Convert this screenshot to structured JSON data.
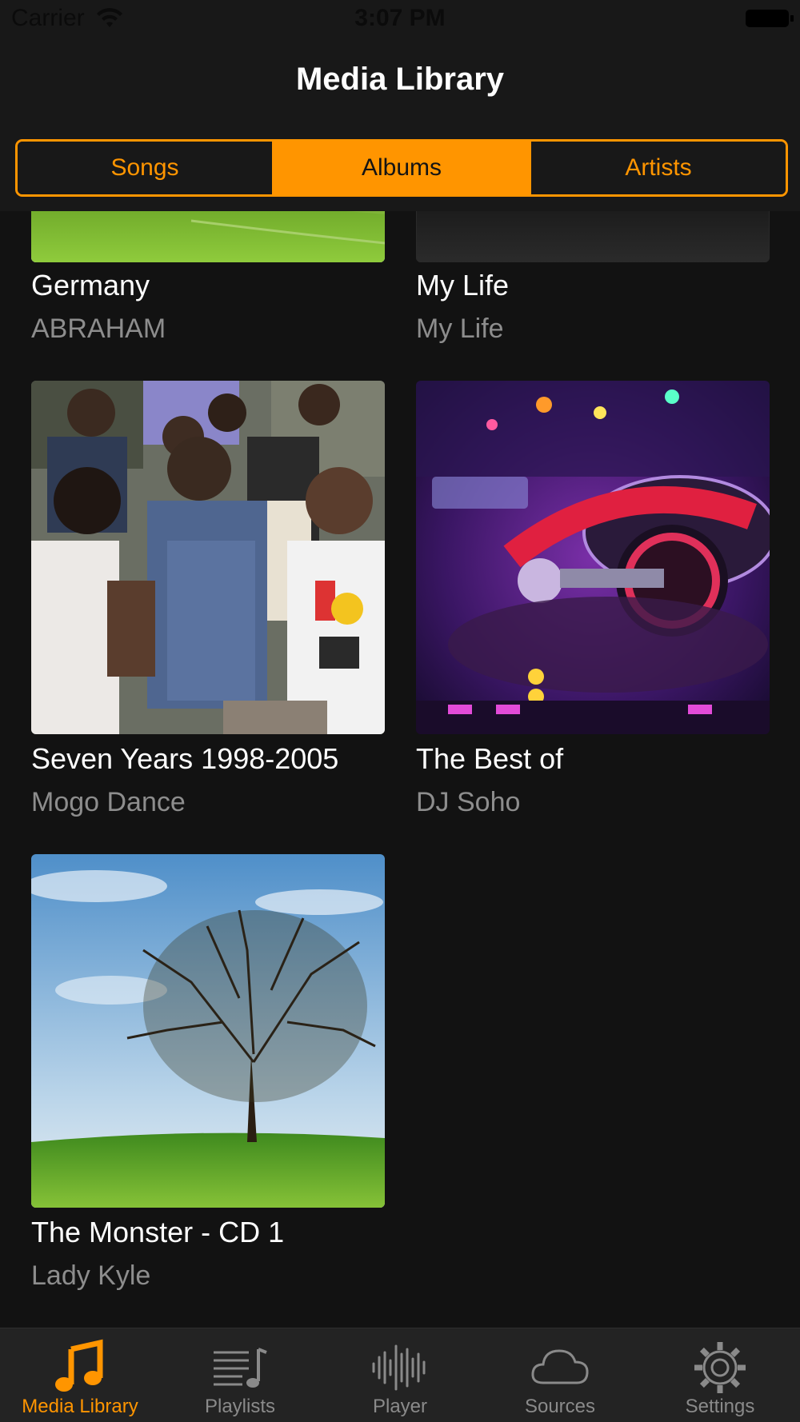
{
  "status_bar": {
    "carrier": "Carrier",
    "time": "3:07 PM"
  },
  "nav": {
    "title": "Media Library"
  },
  "segments": [
    {
      "label": "Songs",
      "active": false
    },
    {
      "label": "Albums",
      "active": true
    },
    {
      "label": "Artists",
      "active": false
    }
  ],
  "albums": [
    {
      "title": "Germany",
      "artist": "ABRAHAM"
    },
    {
      "title": "My Life",
      "artist": "My Life"
    },
    {
      "title": "Seven Years 1998-2005",
      "artist": "Mogo Dance"
    },
    {
      "title": "The Best of",
      "artist": "DJ Soho"
    },
    {
      "title": "The Monster - CD 1",
      "artist": "Lady Kyle"
    }
  ],
  "tabs": [
    {
      "label": "Media Library",
      "icon": "music-note-icon",
      "active": true
    },
    {
      "label": "Playlists",
      "icon": "playlist-icon",
      "active": false
    },
    {
      "label": "Player",
      "icon": "waveform-icon",
      "active": false
    },
    {
      "label": "Sources",
      "icon": "cloud-icon",
      "active": false
    },
    {
      "label": "Settings",
      "icon": "gear-icon",
      "active": false
    }
  ],
  "colors": {
    "accent": "#ff9500",
    "background": "#121212",
    "bar": "#181818",
    "tab_bar": "#232323",
    "secondary_text": "#8d8d8d"
  }
}
